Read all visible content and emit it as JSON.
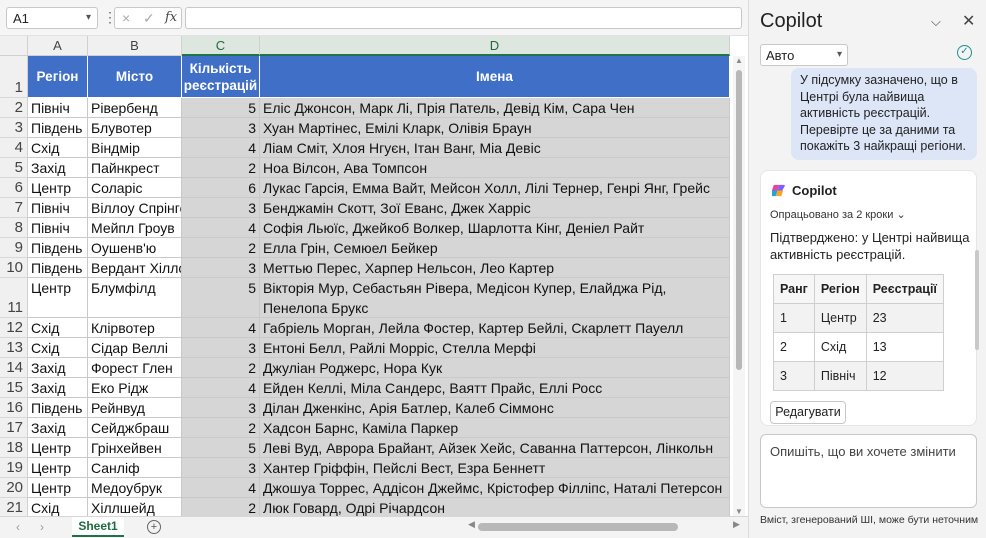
{
  "excel": {
    "name_box": "A1",
    "formula_bar": {
      "cancel_icon": "×",
      "enter_icon": "✓",
      "fx_label": "fx",
      "value": ""
    },
    "column_headers": [
      "A",
      "B",
      "C",
      "D"
    ],
    "header_row": {
      "row_number": "1",
      "region": "Регіон",
      "city": "Місто",
      "count": "Кількість реєстрацій",
      "names": "Імена"
    },
    "rows": [
      {
        "n": "2",
        "region": "Північ",
        "city": "Рівербенд",
        "count": "5",
        "names": "Еліс Джонсон, Марк Лі, Прія Патель, Девід Кім, Сара Чен"
      },
      {
        "n": "3",
        "region": "Південь",
        "city": "Блувотер",
        "count": "3",
        "names": "Хуан Мартінес, Емілі Кларк, Олівія Браун"
      },
      {
        "n": "4",
        "region": "Схід",
        "city": "Віндмір",
        "count": "4",
        "names": "Ліам Сміт, Хлоя Нгуєн, Ітан Ванг, Міа Девіс"
      },
      {
        "n": "5",
        "region": "Захід",
        "city": "Пайнкрест",
        "count": "2",
        "names": "Ноа Вілсон, Ава Томпсон"
      },
      {
        "n": "6",
        "region": "Центр",
        "city": "Соларіс",
        "count": "6",
        "names": "Лукас Гарсія, Емма Вайт, Мейсон Холл, Лілі Тернер, Генрі Янг, Грейс Адамс"
      },
      {
        "n": "7",
        "region": "Північ",
        "city": "Віллоу Спрінгс",
        "count": "3",
        "names": "Бенджамін Скотт, Зої Еванс, Джек Харріс"
      },
      {
        "n": "8",
        "region": "Північ",
        "city": "Мейпл Гроув",
        "count": "4",
        "names": "Софія Льюїс, Джейкоб Волкер, Шарлотта Кінг, Деніел Райт"
      },
      {
        "n": "9",
        "region": "Південь",
        "city": "Оушенв'ю",
        "count": "2",
        "names": "Елла Грін, Семюел Бейкер"
      },
      {
        "n": "10",
        "region": "Південь",
        "city": "Вердант Хіллс",
        "count": "3",
        "names": "Меттью Перес, Харпер Нельсон, Лео Картер"
      },
      {
        "n": "11",
        "region": "Центр",
        "city": "Блумфілд",
        "count": "5",
        "names": "Вікторія Мур, Себастьян Рівера, Медісон Купер, Елайджа Рід, Пенелопа Брукс"
      },
      {
        "n": "12",
        "region": "Схід",
        "city": "Клірвотер",
        "count": "4",
        "names": "Габріель Морган, Лейла Фостер, Картер Бейлі, Скарлетт Пауелл"
      },
      {
        "n": "13",
        "region": "Схід",
        "city": "Сідар Веллі",
        "count": "3",
        "names": "Ентоні Белл, Райлі Морріс, Стелла Мерфі"
      },
      {
        "n": "14",
        "region": "Захід",
        "city": "Форест Глен",
        "count": "2",
        "names": "Джуліан Роджерс, Нора Кук"
      },
      {
        "n": "15",
        "region": "Захід",
        "city": "Еко Рідж",
        "count": "4",
        "names": "Ейден Келлі, Міла Сандерс, Ваятт Прайс, Еллі Росс"
      },
      {
        "n": "16",
        "region": "Південь",
        "city": "Рейнвуд",
        "count": "3",
        "names": "Ділан Дженкінс, Арія Батлер, Калеб Сіммонс"
      },
      {
        "n": "17",
        "region": "Захід",
        "city": "Сейджбраш",
        "count": "2",
        "names": "Хадсон Барнс, Каміла Паркер"
      },
      {
        "n": "18",
        "region": "Центр",
        "city": "Грінхейвен",
        "count": "5",
        "names": "Леві Вуд, Аврора Брайант, Айзек Хейс, Саванна Паттерсон, Лінкольн Рассел"
      },
      {
        "n": "19",
        "region": "Центр",
        "city": "Санліф",
        "count": "3",
        "names": "Хантер Гріффін, Пейслі Вест, Езра Беннетт"
      },
      {
        "n": "20",
        "region": "Центр",
        "city": "Медоубрук",
        "count": "4",
        "names": "Джошуа Торрес, Аддісон Джеймс, Крістофер Філліпс, Наталі Петерсон"
      },
      {
        "n": "21",
        "region": "Схід",
        "city": "Хіллшейд",
        "count": "2",
        "names": "Люк Говард, Одрі Річардсон"
      }
    ],
    "sheet_tab": "Sheet1",
    "add_sheet_icon": "+"
  },
  "copilot": {
    "title": "Copilot",
    "mode_select": "Авто",
    "user_message": "У підсумку зазначено, що в Центрі була найвища активність реєстрацій. Перевірте це за даними та покажіть 3 найкращі регіони.",
    "assistant": {
      "name": "Copilot",
      "steps": "Опрацьовано за 2 кроки",
      "message": "Підтверджено: у Центрі найвища активність реєстрацій.",
      "table": {
        "headers": [
          "Ранг",
          "Регіон",
          "Реєстрації"
        ],
        "rows": [
          [
            "1",
            "Центр",
            "23"
          ],
          [
            "2",
            "Схід",
            "13"
          ],
          [
            "3",
            "Північ",
            "12"
          ]
        ]
      },
      "edit_button": "Редагувати"
    },
    "input_placeholder": "Опишіть, що ви хочете змінити",
    "footer": "Вміст, згенерований ШІ, може бути неточним",
    "brand_colors": {
      "header_blue": "#3f6fc7",
      "excel_green": "#217346",
      "bubble": "#dce6f7"
    }
  }
}
